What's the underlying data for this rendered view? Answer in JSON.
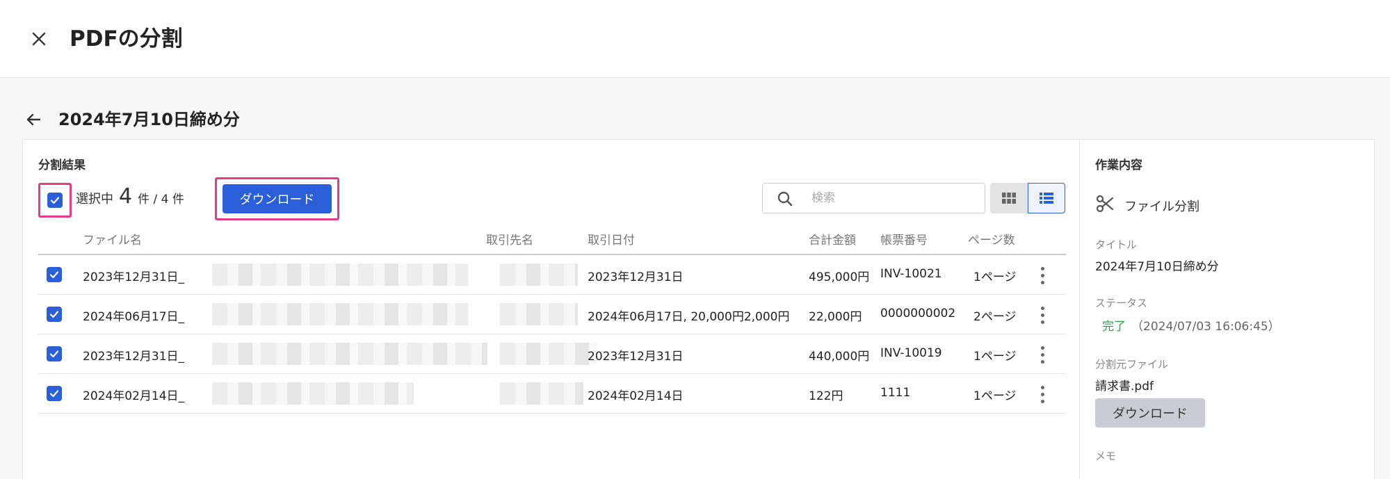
{
  "header": {
    "title": "PDFの分割"
  },
  "page": {
    "title": "2024年7月10日締め分"
  },
  "results": {
    "section_title": "分割結果",
    "selection_label": "選択中",
    "selected_count": "4",
    "total_label": "件 / 4 件",
    "download_label": "ダウンロード",
    "search_placeholder": "検索"
  },
  "table": {
    "columns": {
      "file_name": "ファイル名",
      "partner": "取引先名",
      "date": "取引日付",
      "amount": "合計金額",
      "doc_no": "帳票番号",
      "pages": "ページ数"
    },
    "rows": [
      {
        "file_name": "2023年12月31日_",
        "date": "2023年12月31日",
        "amount": "495,000円",
        "doc_no": "INV-10021",
        "pages": "1ページ"
      },
      {
        "file_name": "2024年06月17日_",
        "date": "2024年06月17日, 20,000円2,000円",
        "amount": "22,000円",
        "doc_no": "0000000002",
        "pages": "2ページ"
      },
      {
        "file_name": "2023年12月31日_",
        "date": "2023年12月31日",
        "amount": "440,000円",
        "doc_no": "INV-10019",
        "pages": "1ページ"
      },
      {
        "file_name": "2024年02月14日_",
        "date": "2024年02月14日",
        "amount": "122円",
        "doc_no": "1111",
        "pages": "1ページ"
      }
    ]
  },
  "details": {
    "section_title": "作業内容",
    "action_label": "ファイル分割",
    "title_label": "タイトル",
    "title_value": "2024年7月10日締め分",
    "status_label": "ステータス",
    "status_value": "完了",
    "status_timestamp": "（2024/07/03 16:06:45）",
    "source_label": "分割元ファイル",
    "source_value": "請求書.pdf",
    "download_label": "ダウンロード",
    "memo_label": "メモ"
  },
  "colors": {
    "primary": "#2b5fd9",
    "highlight": "#e83a86",
    "success": "#2e9e4e"
  }
}
